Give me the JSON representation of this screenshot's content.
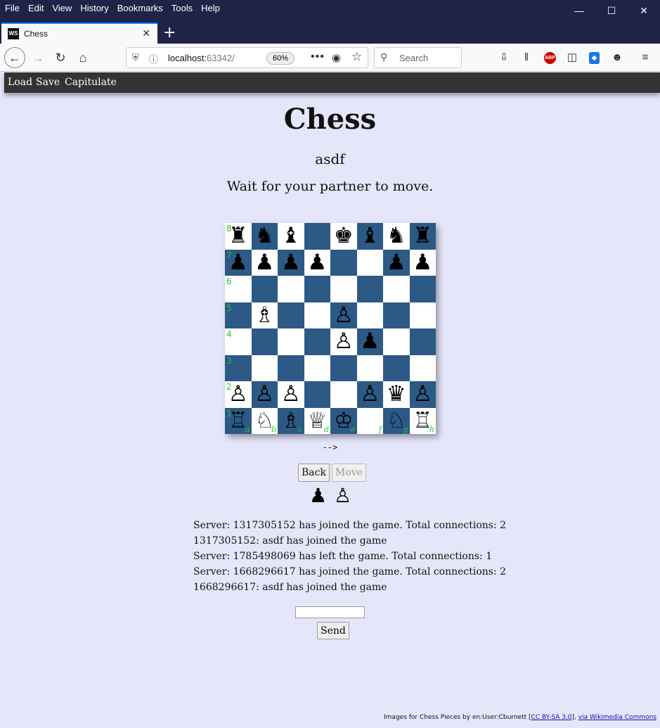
{
  "browser": {
    "menu": [
      "File",
      "Edit",
      "View",
      "History",
      "Bookmarks",
      "Tools",
      "Help"
    ],
    "tab_title": "Chess",
    "favicon_text": "WS",
    "url_host": "localhost:",
    "url_port": "63342/",
    "zoom": "60%",
    "search_placeholder": "Search",
    "abp_label": "ABP"
  },
  "toolbar": {
    "load": "Load",
    "save": "Save",
    "capitulate": "Capitulate"
  },
  "page": {
    "title": "Chess",
    "player": "asdf",
    "status": "Wait for your partner to move.",
    "move_arrow": "-->",
    "back_label": "Back",
    "move_label": "Move",
    "send_label": "Send",
    "chat_value": ""
  },
  "board": {
    "ranks": [
      [
        "♜",
        "♞",
        "♝",
        "",
        "♚",
        "♝",
        "♞",
        "♜"
      ],
      [
        "♟",
        "♟",
        "♟",
        "♟",
        "",
        "",
        "♟",
        "♟"
      ],
      [
        "",
        "",
        "",
        "",
        "",
        "",
        "",
        ""
      ],
      [
        "",
        "♗",
        "",
        "",
        "♙",
        "",
        "",
        ""
      ],
      [
        "",
        "",
        "",
        "",
        "♙",
        "♟",
        "",
        ""
      ],
      [
        "",
        "",
        "",
        "",
        "",
        "",
        "",
        ""
      ],
      [
        "♙",
        "♙",
        "♙",
        "",
        "",
        "♙",
        "♛",
        "♙"
      ],
      [
        "♖",
        "♘",
        "♗",
        "♕",
        "♔",
        "",
        "♘",
        "♖"
      ]
    ],
    "rank_labels": [
      "8",
      "7",
      "6",
      "5",
      "4",
      "3",
      "2",
      "1"
    ],
    "file_labels": [
      "a",
      "b",
      "c",
      "d",
      "e",
      "f",
      "g",
      "h"
    ]
  },
  "turn_indicator": {
    "black": "♟",
    "white": "♙"
  },
  "log": [
    "Server: 1317305152 has joined the game. Total connections: 2",
    "1317305152: asdf has joined the game",
    "Server: 1785498069 has left the game. Total connections: 1",
    "Server: 1668296617 has joined the game. Total connections: 2",
    "1668296617: asdf has joined the game"
  ],
  "footer": {
    "text": "Images for Chess Pieces by en:User:Cburnett [",
    "license": "CC BY-SA 3.0",
    "sep": "], ",
    "source": "via Wikimedia Commons"
  },
  "colors": {
    "dark_square": "#2c5985",
    "light_square": "#ffffff",
    "coord_label": "#22cc22",
    "page_bg": "#e6e6fb"
  }
}
